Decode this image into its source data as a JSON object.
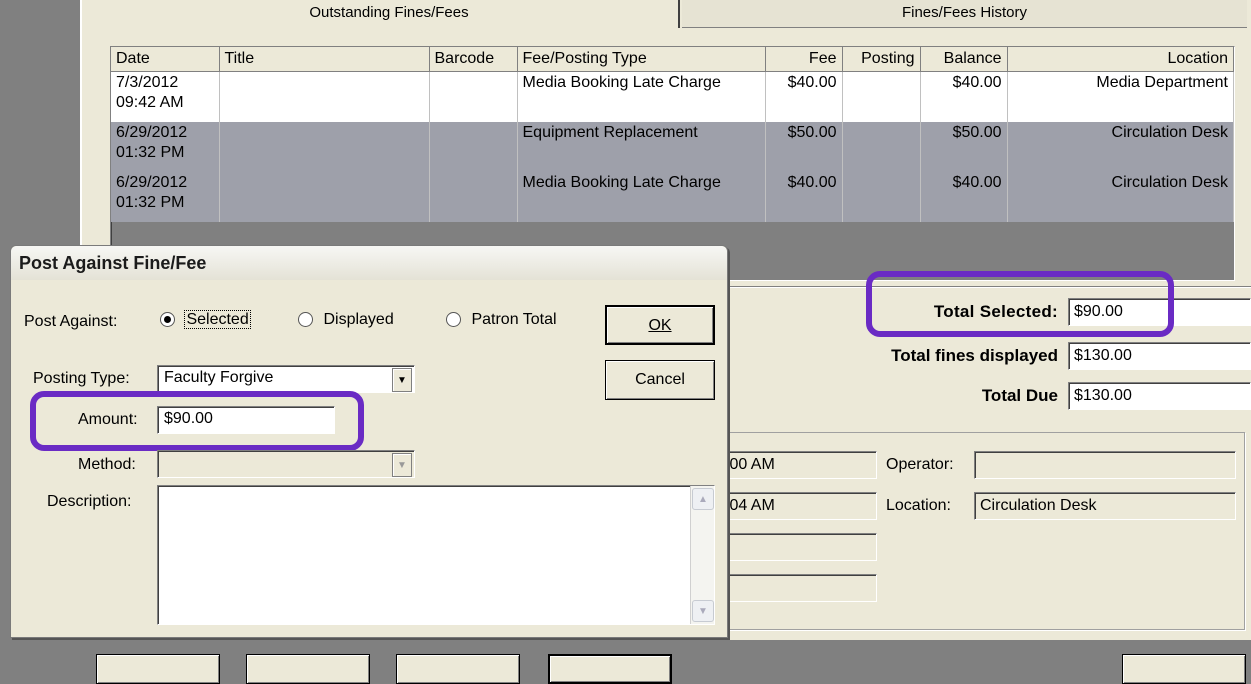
{
  "tabs": [
    {
      "label": "Outstanding Fines/Fees"
    },
    {
      "label": "Fines/Fees History"
    }
  ],
  "grid": {
    "columns": [
      "Date",
      "Title",
      "Barcode",
      "Fee/Posting Type",
      "Fee",
      "Posting",
      "Balance",
      "Location"
    ],
    "rows": [
      {
        "date1": "7/3/2012",
        "date2": "09:42 AM",
        "title": "",
        "barcode": "",
        "type": "Media Booking Late Charge",
        "fee": "$40.00",
        "posting": "",
        "balance": "$40.00",
        "location": "Media Department",
        "selected": false
      },
      {
        "date1": "6/29/2012",
        "date2": "01:32 PM",
        "title": "",
        "barcode": "",
        "type": "Equipment Replacement",
        "fee": "$50.00",
        "posting": "",
        "balance": "$50.00",
        "location": "Circulation Desk",
        "selected": true
      },
      {
        "date1": "6/29/2012",
        "date2": "01:32 PM",
        "title": "",
        "barcode": "",
        "type": "Media Booking Late Charge",
        "fee": "$40.00",
        "posting": "",
        "balance": "$40.00",
        "location": "Circulation Desk",
        "selected": true
      }
    ]
  },
  "totals": {
    "selected_label": "Total Selected:",
    "selected_value": "$90.00",
    "displayed_label": "Total fines displayed",
    "displayed_value": "$130.00",
    "due_label": "Total Due",
    "due_value": "$130.00"
  },
  "details": {
    "time1": ":00 AM",
    "time2": ":04 AM",
    "operator_label": "Operator:",
    "operator_value": "",
    "location_label": "Location:",
    "location_value": "Circulation Desk"
  },
  "dialog": {
    "title": "Post Against Fine/Fee",
    "post_against_label": "Post Against:",
    "options": {
      "selected": "Selected",
      "displayed": "Displayed",
      "patron_total": "Patron Total"
    },
    "posting_type_label": "Posting Type:",
    "posting_type_value": "Faculty Forgive",
    "amount_label": "Amount:",
    "amount_value": "$90.00",
    "method_label": "Method:",
    "method_value": "",
    "description_label": "Description:",
    "description_value": "",
    "ok_label": "OK",
    "cancel_label": "Cancel"
  },
  "highlight_color": "#6a2bc4"
}
